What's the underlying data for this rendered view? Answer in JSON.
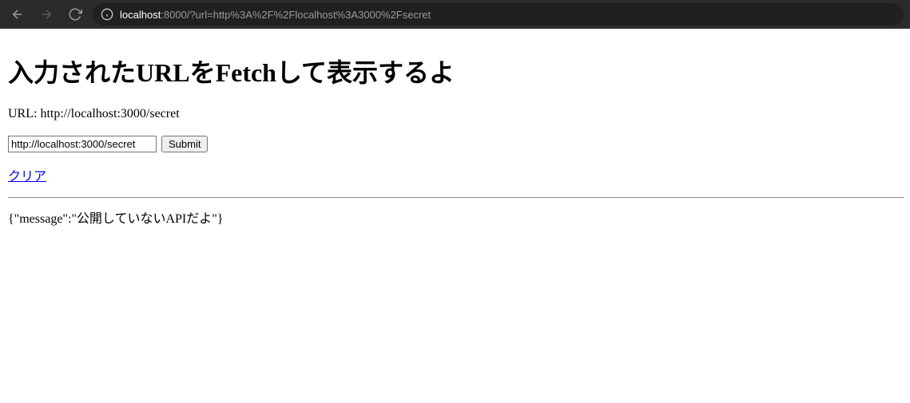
{
  "browser": {
    "address_host": "localhost",
    "address_rest": ":8000/?url=http%3A%2F%2Flocalhost%3A3000%2Fsecret"
  },
  "page": {
    "heading": "入力されたURLをFetchして表示するよ",
    "url_label_prefix": "URL: ",
    "url_value": "http://localhost:3000/secret",
    "input_value": "http://localhost:3000/secret",
    "submit_label": "Submit",
    "clear_label": "クリア",
    "response_text": "{\"message\":\"公開していないAPIだよ\"}"
  }
}
